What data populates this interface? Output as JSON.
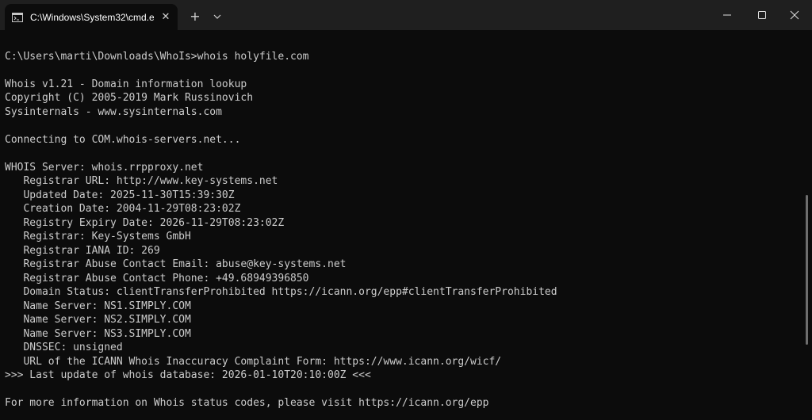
{
  "window": {
    "tab_title": "C:\\Windows\\System32\\cmd.e",
    "tab_icon": "cmd-icon",
    "close_tab_glyph": "✕",
    "new_tab_glyph": "+",
    "colors": {
      "titlebar": "#1f1f1f",
      "terminal_bg": "#0c0c0c",
      "text": "#cccccc"
    }
  },
  "terminal": {
    "lines": [
      "C:\\Users\\marti\\Downloads\\WhoIs>whois holyfile.com",
      "",
      "Whois v1.21 - Domain information lookup",
      "Copyright (C) 2005-2019 Mark Russinovich",
      "Sysinternals - www.sysinternals.com",
      "",
      "Connecting to COM.whois-servers.net...",
      "",
      "WHOIS Server: whois.rrpproxy.net",
      "   Registrar URL: http://www.key-systems.net",
      "   Updated Date: 2025-11-30T15:39:30Z",
      "   Creation Date: 2004-11-29T08:23:02Z",
      "   Registry Expiry Date: 2026-11-29T08:23:02Z",
      "   Registrar: Key-Systems GmbH",
      "   Registrar IANA ID: 269",
      "   Registrar Abuse Contact Email: abuse@key-systems.net",
      "   Registrar Abuse Contact Phone: +49.68949396850",
      "   Domain Status: clientTransferProhibited https://icann.org/epp#clientTransferProhibited",
      "   Name Server: NS1.SIMPLY.COM",
      "   Name Server: NS2.SIMPLY.COM",
      "   Name Server: NS3.SIMPLY.COM",
      "   DNSSEC: unsigned",
      "   URL of the ICANN Whois Inaccuracy Complaint Form: https://www.icann.org/wicf/",
      ">>> Last update of whois database: 2026-01-10T20:10:00Z <<<",
      "",
      "For more information on Whois status codes, please visit https://icann.org/epp"
    ]
  }
}
